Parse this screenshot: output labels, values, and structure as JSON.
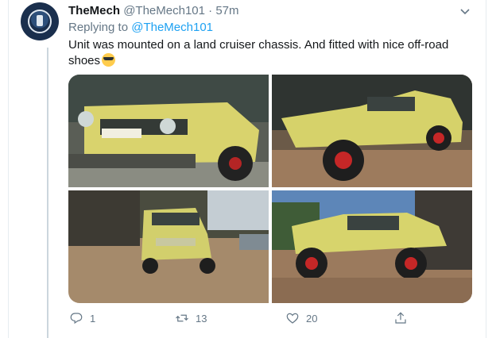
{
  "tweet": {
    "display_name": "TheMech",
    "handle": "@TheMech101",
    "separator": "·",
    "time": "57m",
    "replying_label": "Replying to",
    "replying_to": "@TheMech101",
    "text": "Unit was mounted on a land cruiser chassis. And fitted with nice off-road shoes",
    "emoji": "smiling-face-with-sunglasses"
  },
  "actions": {
    "reply_count": "1",
    "retweet_count": "13",
    "like_count": "20"
  },
  "colors": {
    "link": "#1da1f2",
    "muted": "#657786",
    "text": "#14171a",
    "car_yellow": "#d8d46a"
  },
  "icons": [
    "more-caret-icon",
    "reply-icon",
    "retweet-icon",
    "like-icon",
    "share-icon"
  ]
}
